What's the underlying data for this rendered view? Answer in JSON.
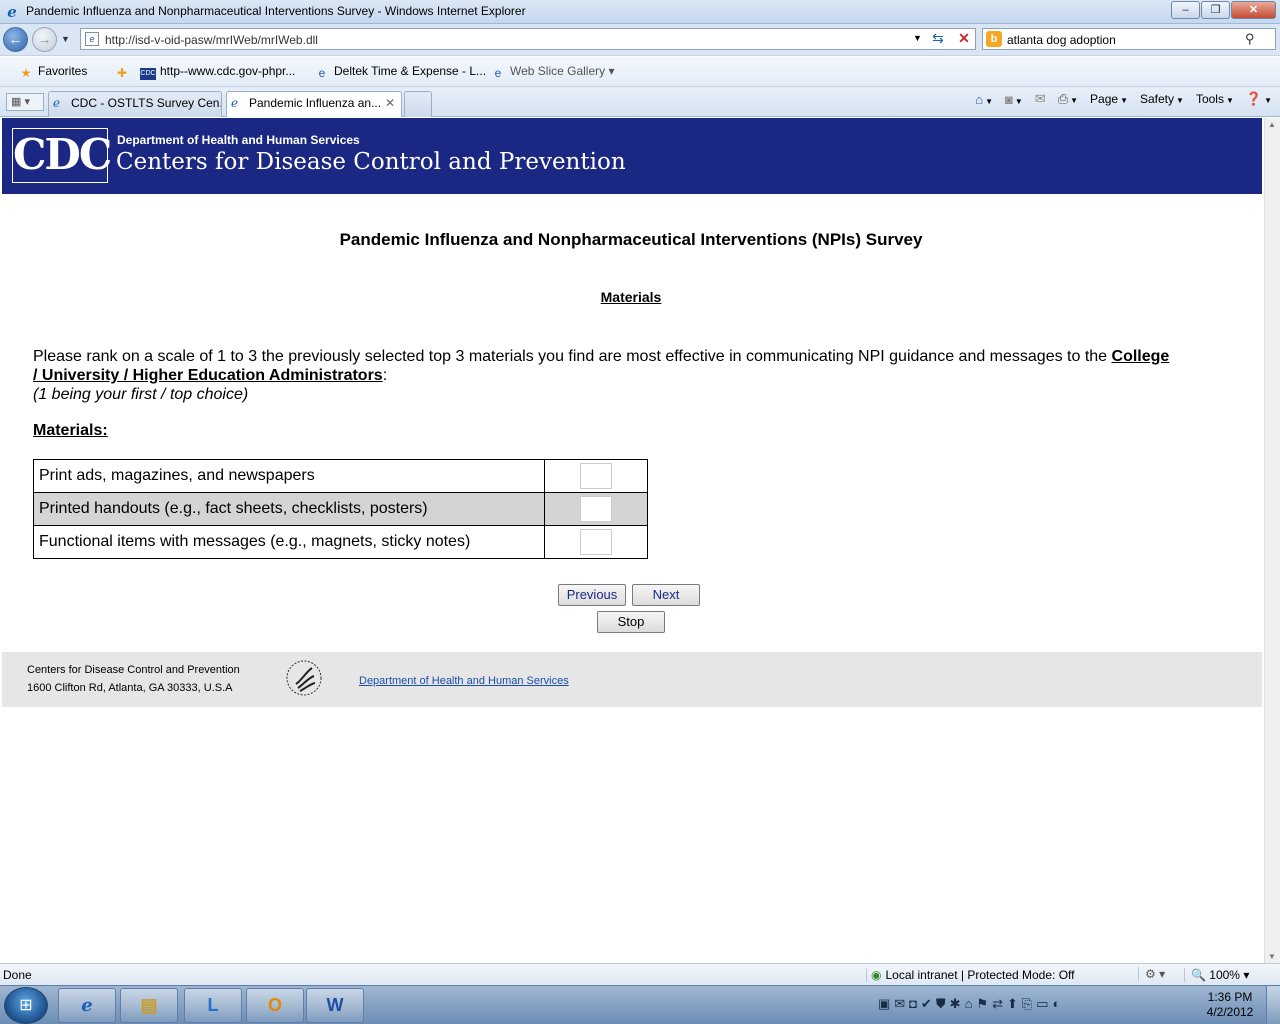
{
  "window": {
    "title": "Pandemic Influenza and Nonpharmaceutical Interventions Survey - Windows Internet Explorer",
    "controls": {
      "minimize": "–",
      "maximize": "❐",
      "close": "✕"
    }
  },
  "address_bar": {
    "url": "http://isd-v-oid-pasw/mrIWeb/mrIWeb.dll",
    "search_query": "atlanta dog adoption"
  },
  "favorites_bar": {
    "favorites_label": "Favorites",
    "items": [
      {
        "label": "http--www.cdc.gov-phpr..."
      },
      {
        "label": "Deltek Time & Expense - L..."
      },
      {
        "label": "Web Slice Gallery"
      }
    ]
  },
  "tabs": [
    {
      "label": "CDC - OSTLTS Survey Cen..."
    },
    {
      "label": "Pandemic Influenza an..."
    }
  ],
  "command_bar": {
    "page": "Page",
    "safety": "Safety",
    "tools": "Tools"
  },
  "header": {
    "logo": "CDC",
    "dept": "Department of Health and Human Services",
    "agency": "Centers for Disease Control and Prevention"
  },
  "survey": {
    "title": "Pandemic Influenza and Nonpharmaceutical Interventions (NPIs) Survey",
    "section": "Materials",
    "question_prefix": "Please rank on a scale of 1 to 3 the previously selected top 3 materials you find are most effective in communicating NPI guidance and messages to the ",
    "question_audience": "College / University / Higher Education Administrators",
    "question_suffix": ":",
    "question_note": "(1 being your first / top choice)",
    "materials_label": "Materials:",
    "rows": [
      {
        "label": "Print ads, magazines, and newspapers",
        "value": ""
      },
      {
        "label": "Printed handouts (e.g., fact sheets, checklists, posters)",
        "value": ""
      },
      {
        "label": "Functional items with messages (e.g., magnets, sticky notes)",
        "value": ""
      }
    ],
    "buttons": {
      "previous": "Previous",
      "next": "Next",
      "stop": "Stop"
    }
  },
  "footer": {
    "line1": "Centers for Disease Control and Prevention",
    "line2": "1600 Clifton Rd, Atlanta, GA 30333, U.S.A",
    "link": "Department of Health and Human Services"
  },
  "status_bar": {
    "status": "Done",
    "zone": "Local intranet | Protected Mode: Off",
    "zoom": "100%"
  },
  "taskbar": {
    "time": "1:36 PM",
    "date": "4/2/2012"
  },
  "colors": {
    "cdc_header": "#1a2883",
    "footer_bg": "#e6e6e6",
    "alt_row": "#d4d4d4"
  }
}
